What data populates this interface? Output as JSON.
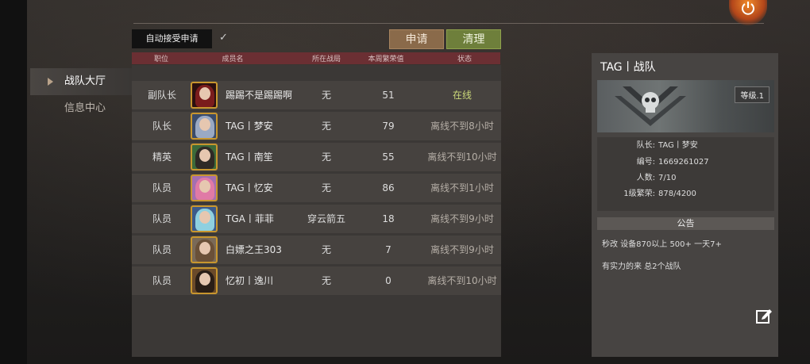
{
  "nav": {
    "items": [
      {
        "label": "战队大厅",
        "active": true
      },
      {
        "label": "信息中心",
        "active": false
      }
    ]
  },
  "controls": {
    "auto_accept_label": "自动接受申请",
    "auto_accept_checked_glyph": "✓",
    "apply_label": "申请",
    "clear_label": "清理"
  },
  "table": {
    "headers": [
      "职位",
      "成员名",
      "所在战局",
      "本周繁荣值",
      "状态"
    ],
    "rows": [
      {
        "role": "副队长",
        "name": "踢踢不是踢踢啊",
        "match": "无",
        "prosperity": "51",
        "status": "在线",
        "online": true,
        "hair": "#7a1c1c",
        "avatar_bg": "#2a1010"
      },
      {
        "role": "队长",
        "name": "TAG丨梦安",
        "match": "无",
        "prosperity": "79",
        "status": "离线不到8小时",
        "online": false,
        "hair": "#9aa9c4",
        "avatar_bg": "#3a4b6a"
      },
      {
        "role": "精英",
        "name": "TAG丨南笙",
        "match": "无",
        "prosperity": "55",
        "status": "离线不到10小时",
        "online": false,
        "hair": "#2f2a26",
        "avatar_bg": "#3c6a3a"
      },
      {
        "role": "队员",
        "name": "TAG丨忆安",
        "match": "无",
        "prosperity": "86",
        "status": "离线不到1小时",
        "online": false,
        "hair": "#e07aa6",
        "avatar_bg": "#a46fb0"
      },
      {
        "role": "队员",
        "name": "TGA丨菲菲",
        "match": "穿云箭五",
        "prosperity": "18",
        "status": "离线不到9小时",
        "online": false,
        "hair": "#8fd0e0",
        "avatar_bg": "#3c5a8a"
      },
      {
        "role": "队员",
        "name": "白嫖之王303",
        "match": "无",
        "prosperity": "7",
        "status": "离线不到9小时",
        "online": false,
        "hair": "#6a5038",
        "avatar_bg": "#7a6a58"
      },
      {
        "role": "队员",
        "name": "忆初丨逸川",
        "match": "无",
        "prosperity": "0",
        "status": "离线不到10小时",
        "online": false,
        "hair": "#2a1e16",
        "avatar_bg": "#6a4a2a"
      }
    ]
  },
  "team": {
    "title": "TAG丨战队",
    "level": "等级.1",
    "details": [
      {
        "key": "队长:",
        "value": "TAG丨梦安"
      },
      {
        "key": "编号:",
        "value": "1669261027"
      },
      {
        "key": "人数:",
        "value": "7/10"
      },
      {
        "key": "1级繁荣:",
        "value": "878/4200"
      }
    ],
    "notice_header": "公告",
    "notice_lines": [
      "秒改 设备870以上 500+ 一天7+",
      "有实力的来 总2个战队"
    ]
  },
  "colors": {
    "online_status": "#cbd97a",
    "offline_status": "#b5aea6",
    "apply_button": "#8a6a4a",
    "clear_button": "#6e7f3b",
    "header_bar": "#6b2f33"
  },
  "icons": {
    "power": "power-icon",
    "edit": "edit-icon",
    "nav_active": "triangle-right-icon",
    "team_emblem": "skull-emblem-icon"
  }
}
